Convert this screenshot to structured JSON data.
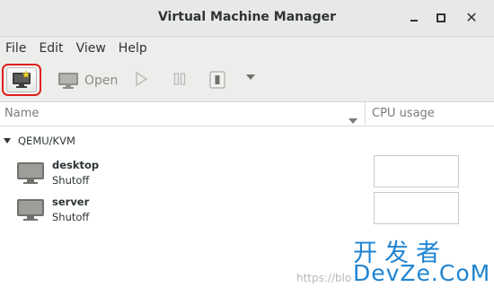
{
  "window": {
    "title": "Virtual Machine Manager",
    "controls": [
      "minimize",
      "maximize",
      "close"
    ],
    "close_glyph": "✕"
  },
  "menu": [
    "File",
    "Edit",
    "View",
    "Help"
  ],
  "toolbar": {
    "new_vm_icon": "new-vm-monitor-icon",
    "new_vm_highlight_color": "#e0201c",
    "open_label": "Open",
    "run_icon": "play-icon",
    "pause_icon": "pause-icon",
    "shutdown_icon": "stop-icon",
    "menu_icon": "dropdown-arrow-icon"
  },
  "list": {
    "columns": {
      "name": "Name",
      "cpu": "CPU usage"
    },
    "group": "QEMU/KVM",
    "vms": [
      {
        "name": "desktop",
        "status": "Shutoff"
      },
      {
        "name": "server",
        "status": "Shutoff"
      }
    ]
  },
  "watermark": {
    "chinese": "开发者",
    "url": "https://blo",
    "brand": "DevZe.CoM",
    "color": "#1f84d2"
  }
}
